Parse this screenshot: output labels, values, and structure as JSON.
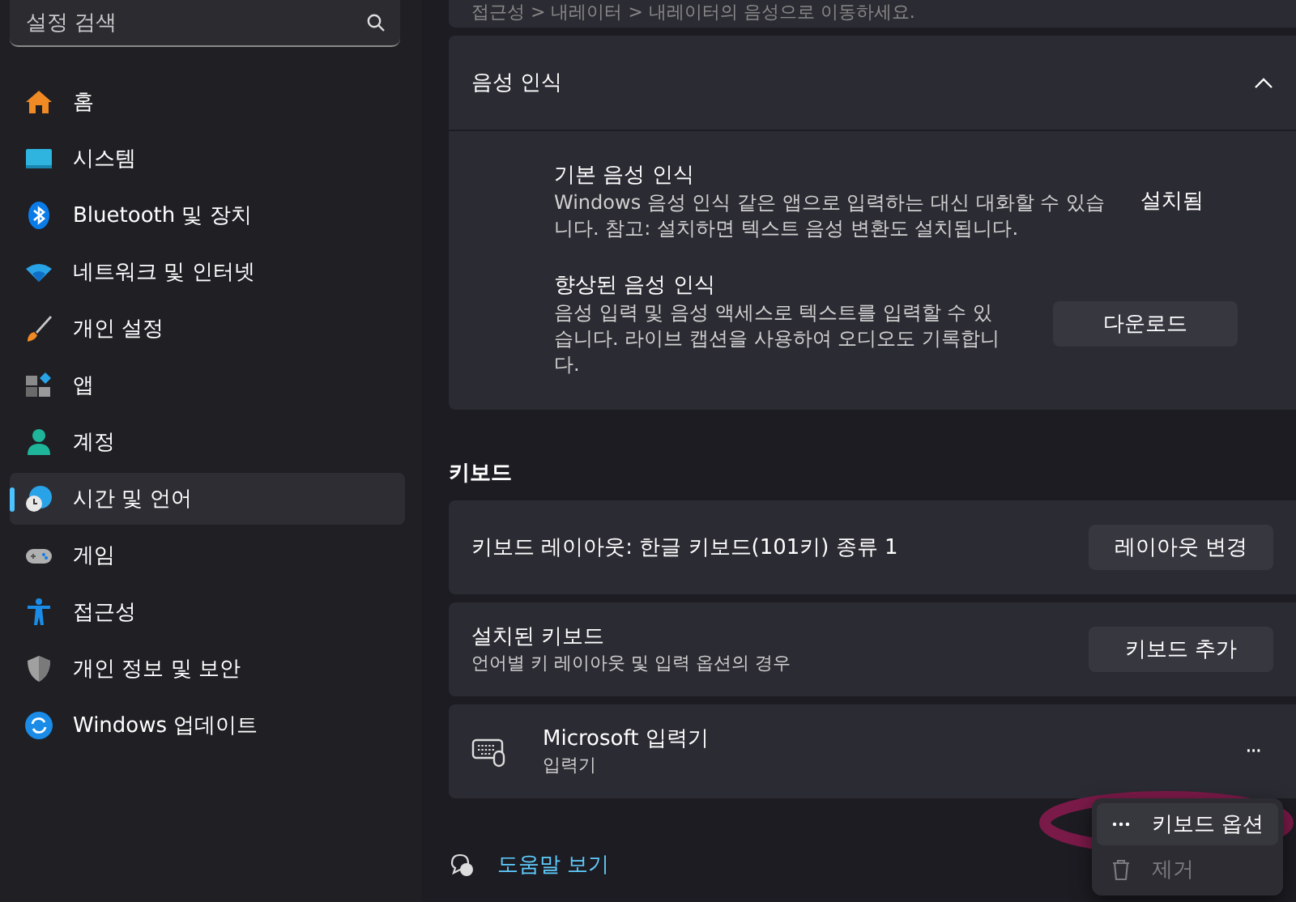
{
  "search": {
    "placeholder": "설정 검색"
  },
  "sidebar": {
    "items": [
      {
        "label": "홈",
        "selected": false
      },
      {
        "label": "시스템",
        "selected": false
      },
      {
        "label": "Bluetooth 및 장치",
        "selected": false
      },
      {
        "label": "네트워크 및 인터넷",
        "selected": false
      },
      {
        "label": "개인 설정",
        "selected": false
      },
      {
        "label": "앱",
        "selected": false
      },
      {
        "label": "계정",
        "selected": false
      },
      {
        "label": "시간 및 언어",
        "selected": true
      },
      {
        "label": "게임",
        "selected": false
      },
      {
        "label": "접근성",
        "selected": false
      },
      {
        "label": "개인 정보 및 보안",
        "selected": false
      },
      {
        "label": "Windows 업데이트",
        "selected": false
      }
    ]
  },
  "top_note": "접근성 > 내레이터 > 내레이터의 음성으로 이동하세요.",
  "speech": {
    "title": "음성 인식",
    "expanded": true,
    "items": [
      {
        "title": "기본 음성 인식",
        "description": "Windows 음성 인식 같은 앱으로 입력하는 대신 대화할 수 있습니다. 참고: 설치하면 텍스트 음성 변환도 설치됩니다.",
        "kind": "status",
        "action": "설치됨"
      },
      {
        "title": "향상된 음성 인식",
        "description": "음성 입력 및 음성 액세스로 텍스트를 입력할 수 있습니다. 라이브 캡션을 사용하여 오디오도 기록합니다.",
        "kind": "button",
        "action": "다운로드"
      }
    ]
  },
  "keyboard": {
    "heading": "키보드",
    "rows": [
      {
        "kind": "plain",
        "title": "키보드 레이아웃: 한글 키보드(101키) 종류 1",
        "button": "레이아웃 변경"
      },
      {
        "kind": "plain",
        "title": "설치된 키보드",
        "subtitle": "언어별 키 레이아웃 및 입력 옵션의 경우",
        "button": "키보드 추가"
      },
      {
        "kind": "ime",
        "title": "Microsoft 입력기",
        "subtitle": "입력기",
        "more": "···"
      }
    ]
  },
  "context_menu": {
    "items": [
      {
        "label": "키보드 옵션",
        "disabled": false,
        "highlighted": true
      },
      {
        "label": "제거",
        "disabled": true,
        "highlighted": false
      }
    ]
  },
  "help_link": "도움말 보기"
}
